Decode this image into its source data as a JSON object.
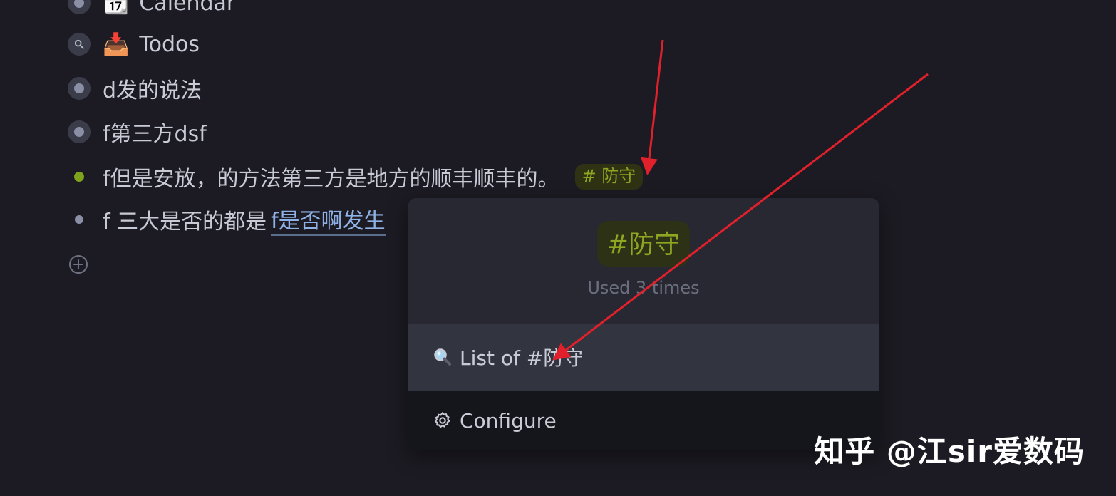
{
  "outline": {
    "items": [
      {
        "emoji": "📆",
        "label": "Calendar",
        "bullet": "ring"
      },
      {
        "emoji": "📥",
        "label": "Todos",
        "bullet": "search"
      },
      {
        "label": "d发的说法",
        "bullet": "ring"
      },
      {
        "label": "f第三方dsf",
        "bullet": "ring"
      },
      {
        "label": "f但是安放，的方法第三方是地方的顺丰顺丰的。",
        "bullet": "green",
        "tag": "# 防守"
      },
      {
        "label": "f 三大是否的都是",
        "bullet": "plain",
        "link": "f是否啊发生"
      }
    ],
    "add_icon": "plus-circle-icon"
  },
  "popup": {
    "tag": "#防守",
    "usage": "Used 3 times",
    "list_icon": "magnifier-icon",
    "list_label": "List of #防守",
    "configure_icon": "gear-icon",
    "configure_label": "Configure"
  },
  "watermark": "知乎 @江sir爱数码",
  "colors": {
    "background": "#1c1b23",
    "tag_text": "#8ea621",
    "tag_bg": "#2f3314",
    "link": "#8fb2e6",
    "annotation_arrow": "#e0202a"
  }
}
